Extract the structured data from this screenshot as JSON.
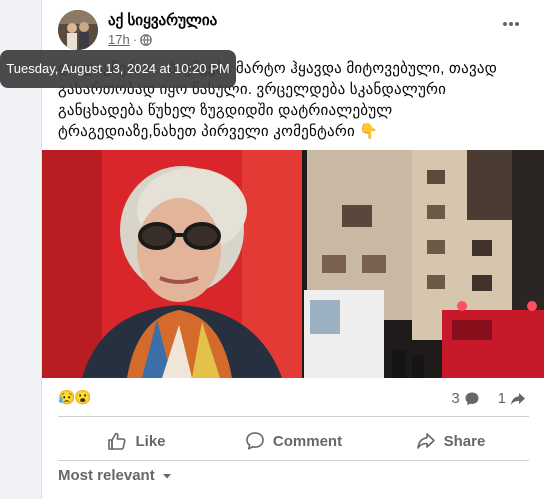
{
  "post": {
    "author": "აქ სიყვარულია",
    "time": "17h",
    "time_separator": "·",
    "privacy_icon": "globe-icon",
    "text_before": "და დავწერო... ბავშვები მარტო ჰყავდა მიტოვებული, თავად გასართობად იყო წასული. ვრცელდება სკანდალური განცხადება წუხელ ზუგდიდში დატრიალებულ ტრაგედიაზე,ნახეთ პირველი კომენტარი",
    "pointer_emoji": "👇",
    "reactions": [
      "😥",
      "😮"
    ],
    "comment_count": "3",
    "share_count": "1",
    "more_icon": "more-dots-icon"
  },
  "tooltip": {
    "text": "Tuesday, August 13, 2024 at 10:20 PM"
  },
  "actions": {
    "like_label": "Like",
    "comment_label": "Comment",
    "share_label": "Share"
  },
  "comments": {
    "sort_label": "Most relevant"
  },
  "colors": {
    "text_primary": "#050505",
    "text_secondary": "#65676b",
    "divider": "#ced0d4"
  }
}
